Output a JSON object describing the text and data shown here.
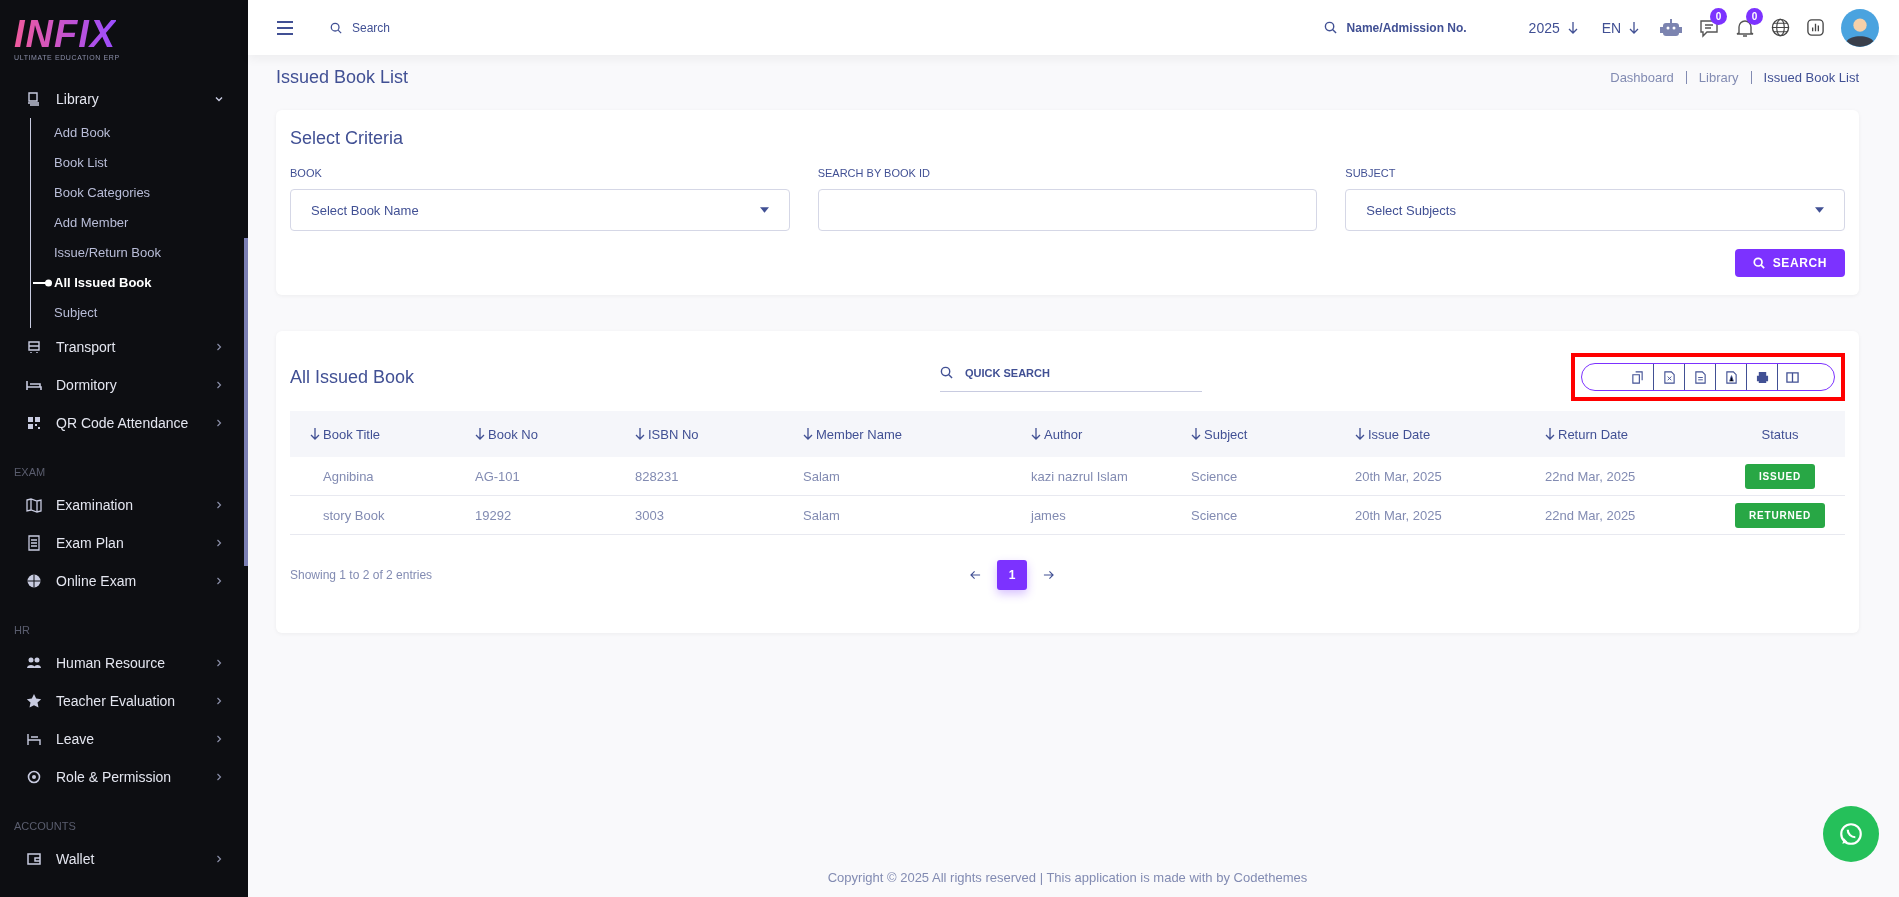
{
  "logo": {
    "title": "INFIX",
    "subtitle": "ULTIMATE EDUCATION ERP"
  },
  "sidebar": {
    "sections": [
      {
        "items": [
          {
            "label": "Library",
            "expanded": true,
            "children": [
              {
                "label": "Add Book",
                "selected": false
              },
              {
                "label": "Book List",
                "selected": false
              },
              {
                "label": "Book Categories",
                "selected": false
              },
              {
                "label": "Add Member",
                "selected": false
              },
              {
                "label": "Issue/Return Book",
                "selected": false
              },
              {
                "label": "All Issued Book",
                "selected": true
              },
              {
                "label": "Subject",
                "selected": false
              }
            ]
          },
          {
            "label": "Transport",
            "expanded": false
          },
          {
            "label": "Dormitory",
            "expanded": false
          },
          {
            "label": "QR Code Attendance",
            "expanded": false
          }
        ]
      },
      {
        "heading": "EXAM",
        "items": [
          {
            "label": "Examination",
            "expanded": false
          },
          {
            "label": "Exam Plan",
            "expanded": false
          },
          {
            "label": "Online Exam",
            "expanded": false
          }
        ]
      },
      {
        "heading": "HR",
        "items": [
          {
            "label": "Human Resource",
            "expanded": false
          },
          {
            "label": "Teacher Evaluation",
            "expanded": false
          },
          {
            "label": "Leave",
            "expanded": false
          },
          {
            "label": "Role & Permission",
            "expanded": false
          }
        ]
      },
      {
        "heading": "ACCOUNTS",
        "items": [
          {
            "label": "Wallet",
            "expanded": false
          }
        ]
      }
    ]
  },
  "topbar": {
    "search": {
      "placeholder": "Search"
    },
    "student_search": {
      "placeholder": "Name/Admission No."
    },
    "year": "2025",
    "language": "EN",
    "message_count": "0",
    "notification_count": "0"
  },
  "page": {
    "title": "Issued Book List",
    "breadcrumbs": [
      "Dashboard",
      "Library",
      "Issued Book List"
    ]
  },
  "criteria": {
    "title": "Select Criteria",
    "fields": [
      {
        "label": "BOOK",
        "kind": "select",
        "placeholder": "Select Book Name"
      },
      {
        "label": "SEARCH BY BOOK ID",
        "kind": "input"
      },
      {
        "label": "SUBJECT",
        "kind": "select",
        "placeholder": "Select Subjects"
      }
    ],
    "button": "SEARCH"
  },
  "table": {
    "title": "All Issued Book",
    "quick_search": {
      "placeholder": "QUICK SEARCH"
    },
    "columns": [
      {
        "label": "Book Title",
        "sortable": true
      },
      {
        "label": "Book No",
        "sortable": true
      },
      {
        "label": "ISBN No",
        "sortable": true
      },
      {
        "label": "Member Name",
        "sortable": true
      },
      {
        "label": "Author",
        "sortable": true
      },
      {
        "label": "Subject",
        "sortable": true
      },
      {
        "label": "Issue Date",
        "sortable": true
      },
      {
        "label": "Return Date",
        "sortable": true
      },
      {
        "label": "Status",
        "sortable": false
      }
    ],
    "rows": [
      {
        "cells": [
          "Agnibina",
          "AG-101",
          "828231",
          "Salam",
          "kazi nazrul Islam",
          "Science",
          "20th Mar, 2025",
          "22nd Mar, 2025"
        ],
        "status": "ISSUED"
      },
      {
        "cells": [
          "story Book",
          "19292",
          "3003",
          "Salam",
          "james",
          "Science",
          "20th Mar, 2025",
          "22nd Mar, 2025"
        ],
        "status": "RETURNED"
      }
    ],
    "info": "Showing 1 to 2 of 2 entries",
    "pages": [
      {
        "label": "1",
        "selected": true
      }
    ]
  },
  "footer": "Copyright © 2025 All rights reserved | This application is made with by Codethemes"
}
